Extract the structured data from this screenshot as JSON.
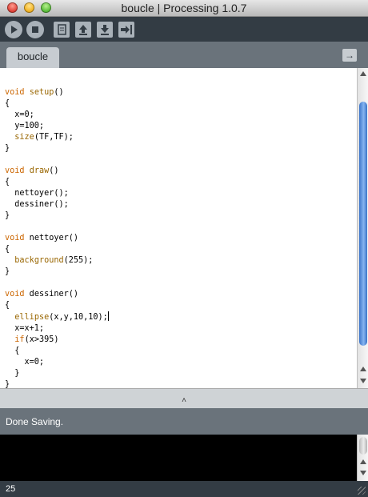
{
  "window": {
    "title": "boucle | Processing 1.0.7"
  },
  "toolbar": {
    "buttons": [
      "run",
      "stop",
      "new",
      "open",
      "save",
      "export"
    ]
  },
  "tabs": [
    {
      "label": "boucle"
    }
  ],
  "editor": {
    "lines": [
      "",
      "void setup()",
      "{",
      "  x=0;",
      "  y=100;",
      "  size(TF,TF);",
      "}",
      "",
      "void draw()",
      "{",
      "  nettoyer();",
      "  dessiner();",
      "}",
      "",
      "void nettoyer()",
      "{",
      "  background(255);",
      "}",
      "",
      "void dessiner()",
      "{",
      "  ellipse(x,y,10,10);",
      "  x=x+1;",
      "  if(x>395)",
      "  {",
      "    x=0;",
      "  }",
      "}"
    ],
    "caret_line": 21
  },
  "status": {
    "message": "Done Saving."
  },
  "footer": {
    "line_number": "25"
  },
  "colors": {
    "keyword": "#cc6600",
    "function": "#996600",
    "toolbar_bg": "#333c44",
    "frame_bg": "#6a737b"
  }
}
